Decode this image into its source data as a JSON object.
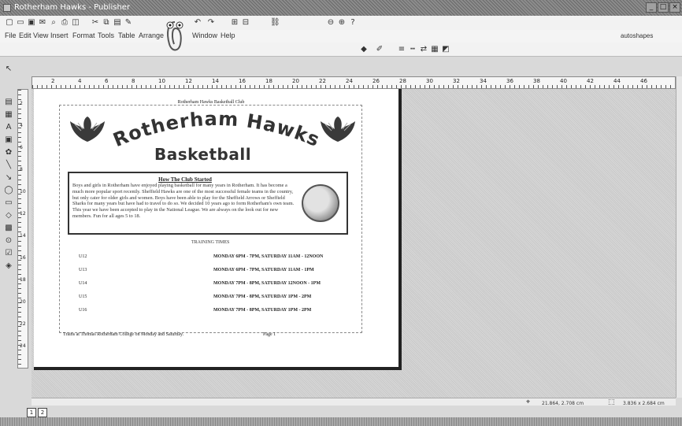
{
  "window": {
    "title": "Rotherham Hawks - Publisher",
    "min": "_",
    "max": "□",
    "close": "×"
  },
  "menu": [
    "File",
    "Edit",
    "View",
    "Insert",
    "Format",
    "Tools",
    "Table",
    "Arrange",
    "Window",
    "Help"
  ],
  "help_field": "autoshapes",
  "ruler_marks": [
    "2",
    "4",
    "6",
    "8",
    "10",
    "12",
    "14",
    "16",
    "18",
    "20",
    "22",
    "24",
    "26",
    "28",
    "30",
    "32",
    "34",
    "36",
    "38",
    "40",
    "42",
    "44",
    "46"
  ],
  "vruler_marks": [
    "2",
    "4",
    "6",
    "8",
    "10",
    "12",
    "14",
    "16",
    "18",
    "20",
    "22",
    "24"
  ],
  "document": {
    "header_line": "Rotherham Hawks Basketball Club",
    "title_line1": "Rotherham Hawks",
    "title_line2": "Basketball",
    "story_title": "How The Club Started",
    "story_body": "Boys and girls in Rotherham have enjoyed playing basketball for many years in Rotherham. It has become a much more popular sport recently. Sheffield Hawks are one of the most successful female teams in the country, but only cater for older girls and women. Boys have been able to play for the Sheffield Arrows or Sheffield Sharks for many years but have had to travel to do so. We decided 10 years ago to form Rotherham's own team. This year we have been accepted to play in the National League. We are always on the look out for new members. Fun for all ages 5 to 18.",
    "training_heading": "TRAINING TIMES",
    "training": [
      {
        "group": "U12",
        "time": "MONDAY 6PM - 7PM, SATURDAY 11AM - 12NOON"
      },
      {
        "group": "U13",
        "time": "MONDAY 6PM - 7PM, SATURDAY 11AM - 1PM"
      },
      {
        "group": "U14",
        "time": "MONDAY 7PM - 8PM, SATURDAY 12NOON - 1PM"
      },
      {
        "group": "U15",
        "time": "MONDAY 7PM - 8PM, SATURDAY 1PM - 2PM"
      },
      {
        "group": "U16",
        "time": "MONDAY 7PM - 8PM, SATURDAY 1PM - 2PM"
      }
    ],
    "footer_left": "Trains at Thomas Rotherham College on Monday and Saturday.",
    "footer_right": "Page 1"
  },
  "status": {
    "position": "21.864, 2.708 cm",
    "size": "3.836 x 2.684 cm"
  },
  "page_tabs": [
    "1",
    "2"
  ]
}
